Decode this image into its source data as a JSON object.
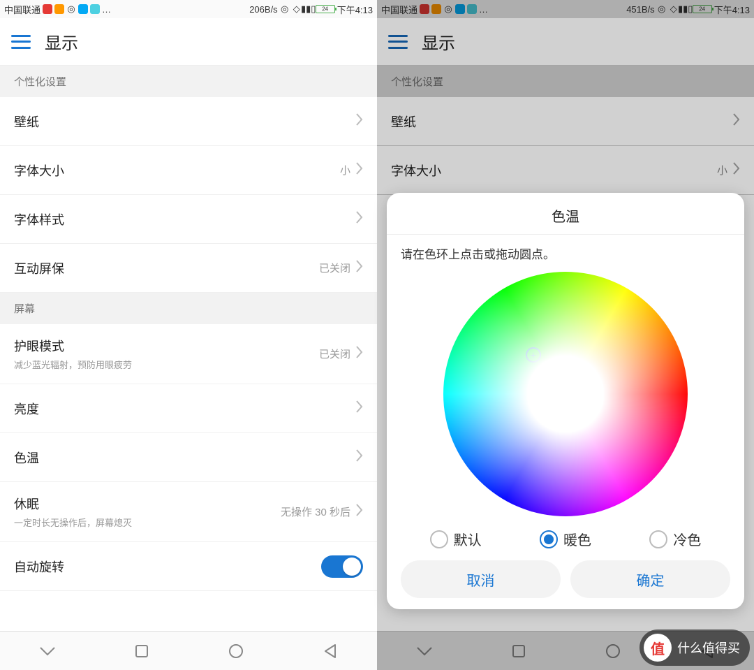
{
  "left": {
    "status": {
      "carrier": "中国联通",
      "speed": "206B/s",
      "battery": "24",
      "time": "下午4:13"
    },
    "header": {
      "title": "显示"
    },
    "section1": {
      "label": "个性化设置"
    },
    "rows1": {
      "wallpaper": {
        "title": "壁纸"
      },
      "fontsize": {
        "title": "字体大小",
        "value": "小"
      },
      "fontstyle": {
        "title": "字体样式"
      },
      "screensaver": {
        "title": "互动屏保",
        "value": "已关闭"
      }
    },
    "section2": {
      "label": "屏幕"
    },
    "rows2": {
      "eyecare": {
        "title": "护眼模式",
        "sub": "减少蓝光辐射，预防用眼疲劳",
        "value": "已关闭"
      },
      "brightness": {
        "title": "亮度"
      },
      "colortemp": {
        "title": "色温"
      },
      "sleep": {
        "title": "休眠",
        "sub": "一定时长无操作后，屏幕熄灭",
        "value": "无操作 30 秒后"
      },
      "autorotate": {
        "title": "自动旋转"
      }
    }
  },
  "right": {
    "status": {
      "carrier": "中国联通",
      "speed": "451B/s",
      "battery": "24",
      "time": "下午4:13"
    },
    "header": {
      "title": "显示"
    },
    "section1": {
      "label": "个性化设置"
    },
    "rows1": {
      "wallpaper": {
        "title": "壁纸"
      },
      "fontsize": {
        "title": "字体大小",
        "value": "小"
      }
    },
    "dialog": {
      "title": "色温",
      "hint": "请在色环上点击或拖动圆点。",
      "opts": {
        "default": "默认",
        "warm": "暖色",
        "cool": "冷色"
      },
      "cancel": "取消",
      "confirm": "确定"
    }
  },
  "watermark": {
    "badge": "值",
    "text": "什么值得买"
  }
}
